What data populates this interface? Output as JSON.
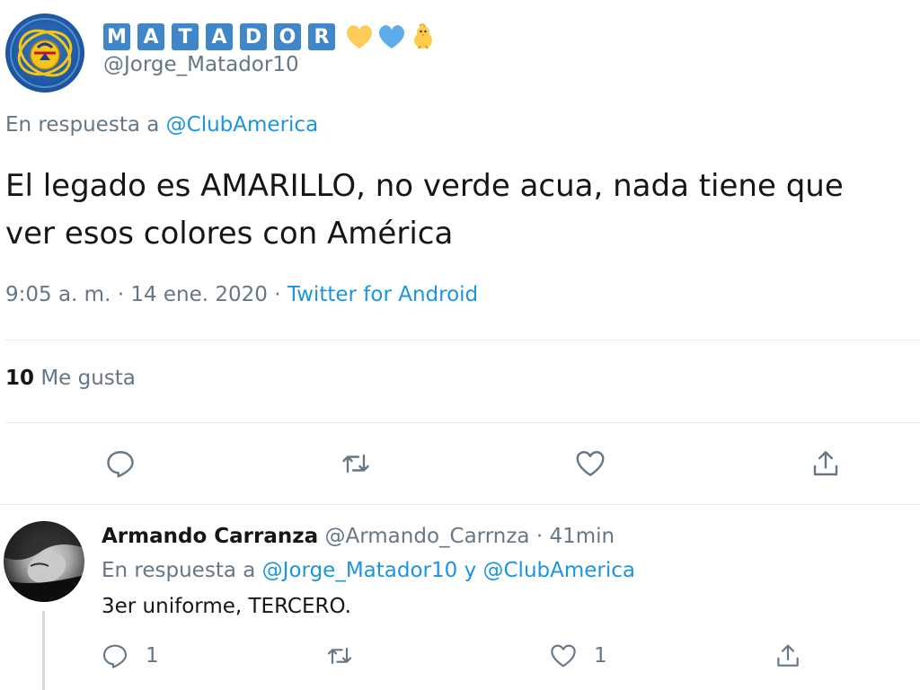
{
  "colors": {
    "accent": "#1b95e0",
    "muted": "#657786",
    "text": "#14171a",
    "tile": "#3f87c9"
  },
  "main_tweet": {
    "name_letters": [
      "M",
      "A",
      "T",
      "A",
      "D",
      "O",
      "R"
    ],
    "name_emojis": [
      "yellow-heart-icon",
      "blue-heart-icon",
      "baby-chick-icon"
    ],
    "handle": "@Jorge_Matador10",
    "reply_prefix": "En respuesta a ",
    "reply_to": "@ClubAmerica",
    "text": "El legado es AMARILLO, no verde acua, nada tiene que\nver esos colores con América",
    "time": "9:05 a. m. · 14 ene. 2020 · ",
    "source": "Twitter for Android",
    "likes_count": "10",
    "likes_label": "Me gusta",
    "actions": [
      "reply-icon",
      "retweet-icon",
      "like-icon",
      "share-icon"
    ]
  },
  "reply": {
    "name": "Armando Carranza",
    "handle": "@Armando_Carrnza",
    "separator": " · ",
    "time": "41min",
    "reply_prefix": "En respuesta a ",
    "reply_to_1": "@Jorge_Matador10",
    "reply_joiner": " y ",
    "reply_to_2": "@ClubAmerica",
    "text": "3er uniforme, TERCERO.",
    "reply_count": "1",
    "like_count": "1"
  }
}
